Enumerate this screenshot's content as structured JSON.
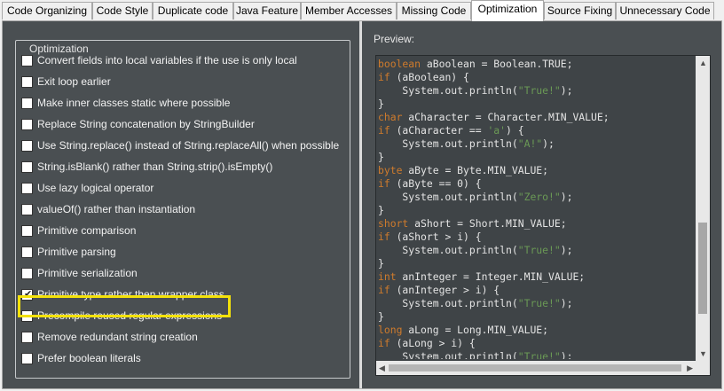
{
  "tabs": [
    {
      "label": "Code Organizing"
    },
    {
      "label": "Code Style"
    },
    {
      "label": "Duplicate code"
    },
    {
      "label": "Java Feature"
    },
    {
      "label": "Member Accesses"
    },
    {
      "label": "Missing Code"
    },
    {
      "label": "Optimization",
      "active": true
    },
    {
      "label": "Source Fixing"
    },
    {
      "label": "Unnecessary Code"
    }
  ],
  "group": {
    "title": "Optimization",
    "options": [
      {
        "label": "Convert fields into local variables if the use is only local",
        "checked": false
      },
      {
        "label": "Exit loop earlier",
        "checked": false
      },
      {
        "label": "Make inner classes static where possible",
        "checked": false
      },
      {
        "label": "Replace String concatenation by StringBuilder",
        "checked": false
      },
      {
        "label": "Use String.replace() instead of String.replaceAll() when possible",
        "checked": false
      },
      {
        "label": "String.isBlank() rather than String.strip().isEmpty()",
        "checked": false
      },
      {
        "label": "Use lazy logical operator",
        "checked": false
      },
      {
        "label": "valueOf() rather than instantiation",
        "checked": false
      },
      {
        "label": "Primitive comparison",
        "checked": false
      },
      {
        "label": "Primitive parsing",
        "checked": false
      },
      {
        "label": "Primitive serialization",
        "checked": false
      },
      {
        "label": "Primitive type rather then wrapper class",
        "checked": true
      },
      {
        "label": "Precompile reused regular expressions",
        "checked": false
      },
      {
        "label": "Remove redundant string creation",
        "checked": false
      },
      {
        "label": "Prefer boolean literals",
        "checked": false
      }
    ]
  },
  "preview": {
    "label": "Preview:",
    "lines": [
      "boolean aBoolean = Boolean.TRUE;",
      "if (aBoolean) {",
      "    System.out.println(\"True!\");",
      "}",
      "char aCharacter = Character.MIN_VALUE;",
      "if (aCharacter == 'a') {",
      "    System.out.println(\"A!\");",
      "}",
      "byte aByte = Byte.MIN_VALUE;",
      "if (aByte == 0) {",
      "    System.out.println(\"Zero!\");",
      "}",
      "short aShort = Short.MIN_VALUE;",
      "if (aShort > i) {",
      "    System.out.println(\"True!\");",
      "}",
      "int anInteger = Integer.MIN_VALUE;",
      "if (anInteger > i) {",
      "    System.out.println(\"True!\");",
      "}",
      "long aLong = Long.MIN_VALUE;",
      "if (aLong > i) {",
      "    System.out.println(\"True!\");"
    ]
  },
  "colors": {
    "panel_bg": "#4a4f52",
    "highlight": "#f4e20a",
    "keyword": "#cf7b2c",
    "string": "#6a9955"
  },
  "icons": {
    "check": "check-icon",
    "scroll_up": "arrow-up-icon",
    "scroll_down": "arrow-down-icon",
    "scroll_left": "arrow-left-icon",
    "scroll_right": "arrow-right-icon"
  }
}
